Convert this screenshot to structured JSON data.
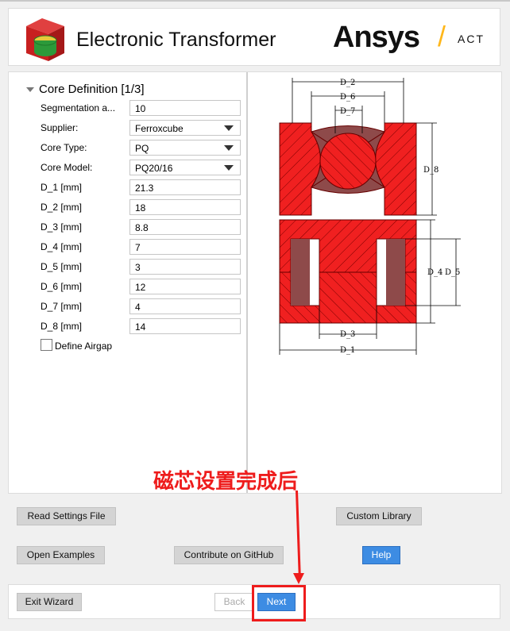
{
  "header": {
    "title": "Electronic Transformer",
    "brand": "Ansys",
    "brand_suffix": "ACT",
    "brand_slash": "/"
  },
  "panel": {
    "section_title": "Core Definition [1/3]",
    "fields": [
      {
        "label": "Segmentation a...",
        "value": "10",
        "type": "text"
      },
      {
        "label": "Supplier:",
        "value": "Ferroxcube",
        "type": "select"
      },
      {
        "label": "Core Type:",
        "value": "PQ",
        "type": "select"
      },
      {
        "label": "Core Model:",
        "value": "PQ20/16",
        "type": "select"
      },
      {
        "label": "D_1 [mm]",
        "value": "21.3",
        "type": "text"
      },
      {
        "label": "D_2 [mm]",
        "value": "18",
        "type": "text"
      },
      {
        "label": "D_3 [mm]",
        "value": "8.8",
        "type": "text"
      },
      {
        "label": "D_4 [mm]",
        "value": "7",
        "type": "text"
      },
      {
        "label": "D_5 [mm]",
        "value": "3",
        "type": "text"
      },
      {
        "label": "D_6 [mm]",
        "value": "12",
        "type": "text"
      },
      {
        "label": "D_7 [mm]",
        "value": "4",
        "type": "text"
      },
      {
        "label": "D_8 [mm]",
        "value": "14",
        "type": "text"
      }
    ],
    "checkbox_label": "Define Airgap"
  },
  "diagram": {
    "labels": {
      "d1": "D_1",
      "d2": "D_2",
      "d3": "D_3",
      "d4": "D_4",
      "d5": "D_5",
      "d6": "D_6",
      "d7": "D_7",
      "d8": "D_8"
    },
    "core_color": "#f02020",
    "window_color": "#8e4a4a"
  },
  "buttons": {
    "read_settings": "Read Settings File",
    "custom_library": "Custom Library",
    "open_examples": "Open Examples",
    "contribute": "Contribute on GitHub",
    "help": "Help",
    "exit": "Exit Wizard",
    "back": "Back",
    "next": "Next"
  },
  "annotation": {
    "text": "磁芯设置完成后",
    "color": "#ee1c1c"
  }
}
